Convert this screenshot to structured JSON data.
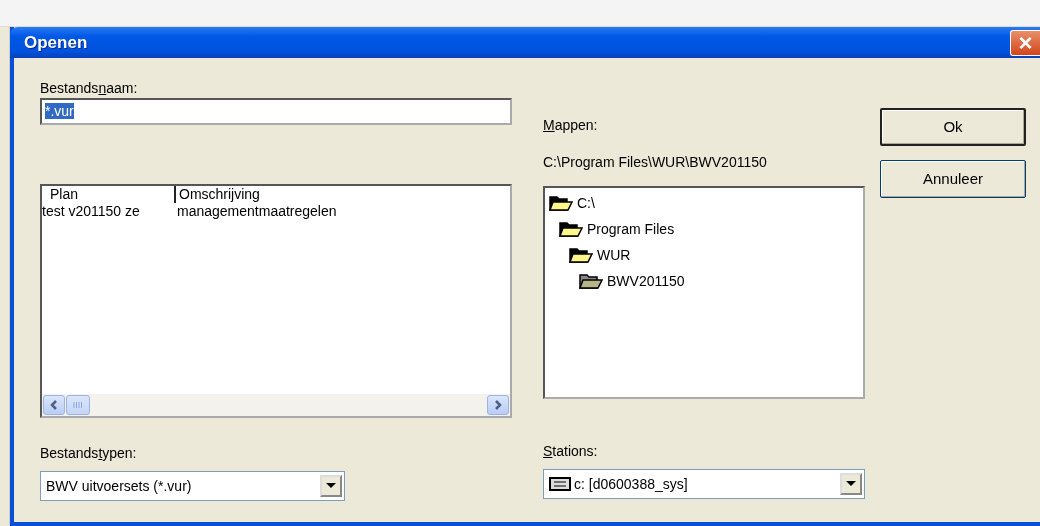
{
  "window": {
    "title": "Openen",
    "close": "×"
  },
  "filename": {
    "label": {
      "before": "Bestands",
      "accel": "n",
      "after": "aam:"
    },
    "value": "*.vur",
    "selected_text": true
  },
  "files": {
    "columns": [
      "Plan",
      "Omschrijving"
    ],
    "rows": [
      {
        "cells": [
          "test v201150 ze",
          "managementmaatregelen"
        ]
      }
    ]
  },
  "folders": {
    "label": {
      "accel": "M",
      "after": "appen:"
    },
    "path": "C:\\Program Files\\WUR\\BWV201150",
    "tree": [
      {
        "name": "C:\\",
        "selected": false,
        "children": [
          {
            "name": "Program Files",
            "selected": false,
            "children": [
              {
                "name": "WUR",
                "selected": false,
                "children": [
                  {
                    "name": "BWV201150",
                    "selected": true
                  }
                ]
              }
            ]
          }
        ]
      }
    ]
  },
  "filetypes": {
    "label": {
      "before": "Bestands",
      "accel": "t",
      "after": "ypen:"
    },
    "value": "BWV uitvoersets (*.vur)"
  },
  "drives": {
    "label": {
      "accel": "S",
      "after": "tations:"
    },
    "value": "c: [d0600388_sys]"
  },
  "buttons": [
    {
      "label": "Ok",
      "default": true
    },
    {
      "label": "Annuleer",
      "default": false
    }
  ]
}
